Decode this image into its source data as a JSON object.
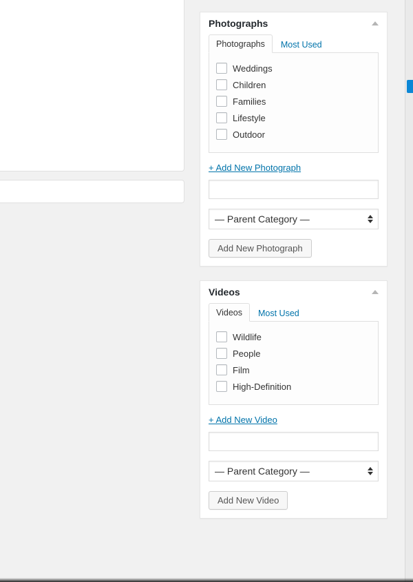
{
  "photographs": {
    "title": "Photographs",
    "tabs": {
      "all": "Photographs",
      "most_used": "Most Used"
    },
    "items": [
      {
        "label": "Weddings"
      },
      {
        "label": "Children"
      },
      {
        "label": "Families"
      },
      {
        "label": "Lifestyle"
      },
      {
        "label": "Outdoor"
      }
    ],
    "add_link": "+ Add New Photograph",
    "parent_placeholder": "— Parent Category —",
    "add_button": "Add New Photograph"
  },
  "videos": {
    "title": "Videos",
    "tabs": {
      "all": "Videos",
      "most_used": "Most Used"
    },
    "items": [
      {
        "label": "Wildlife"
      },
      {
        "label": "People"
      },
      {
        "label": "Film"
      },
      {
        "label": "High-Definition"
      }
    ],
    "add_link": "+ Add New Video",
    "parent_placeholder": "— Parent Category —",
    "add_button": "Add New Video"
  }
}
